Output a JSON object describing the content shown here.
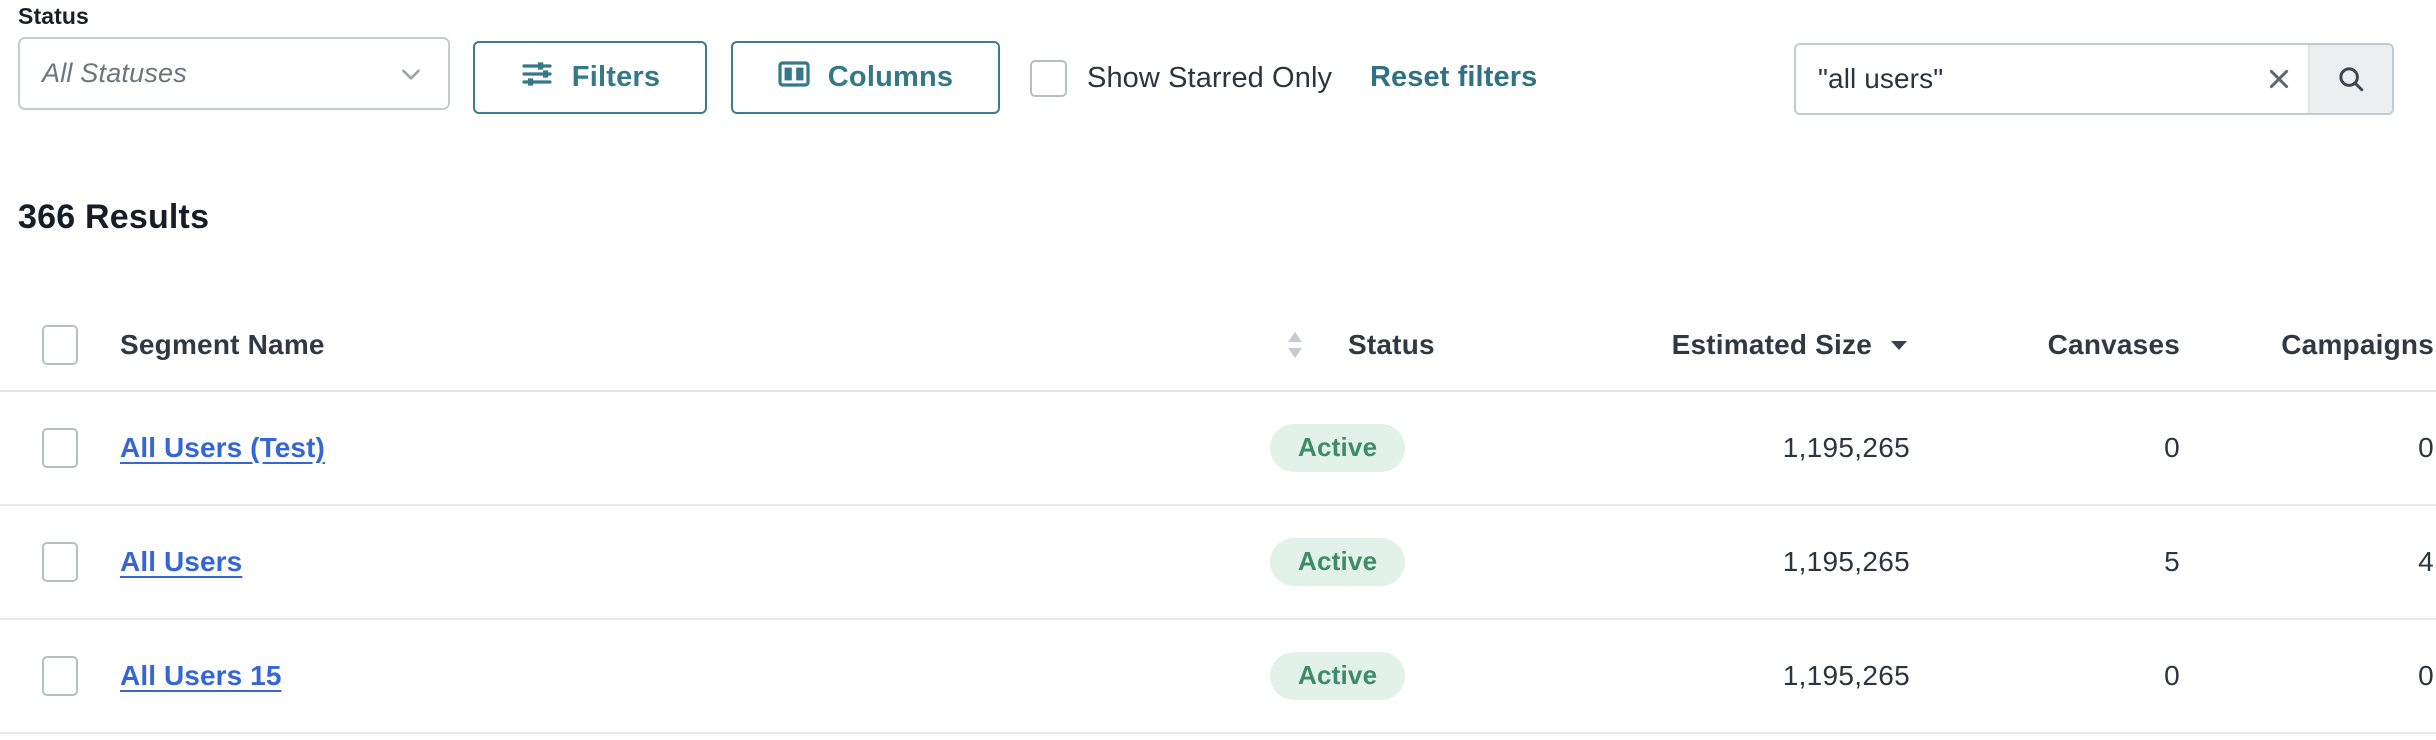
{
  "filters": {
    "status_label": "Status",
    "status_select": {
      "value": "",
      "placeholder": "All Statuses",
      "options": [
        "All Statuses"
      ]
    },
    "filters_button": "Filters",
    "columns_button": "Columns",
    "show_starred_label": "Show Starred Only",
    "show_starred_checked": false,
    "reset_filters_label": "Reset filters",
    "search": {
      "value": "\"all users\"",
      "placeholder": ""
    }
  },
  "results": {
    "count_label": "366 Results"
  },
  "table": {
    "columns": [
      {
        "key": "name",
        "label": "Segment Name",
        "sort": "none"
      },
      {
        "key": "status",
        "label": "Status",
        "sort": null
      },
      {
        "key": "size",
        "label": "Estimated Size",
        "sort": "desc"
      },
      {
        "key": "canvases",
        "label": "Canvases",
        "sort": null
      },
      {
        "key": "campaigns",
        "label": "Campaigns",
        "sort": null
      }
    ],
    "rows": [
      {
        "name": "All Users (Test)",
        "status": "Active",
        "size": "1,195,265",
        "canvases": "0",
        "campaigns": "0",
        "selected": false
      },
      {
        "name": "All Users",
        "status": "Active",
        "size": "1,195,265",
        "canvases": "5",
        "campaigns": "4",
        "selected": false
      },
      {
        "name": "All Users 15",
        "status": "Active",
        "size": "1,195,265",
        "canvases": "0",
        "campaigns": "0",
        "selected": false
      }
    ]
  },
  "colors": {
    "accent_teal": "#35788a",
    "link_blue": "#3566d6",
    "badge_bg": "#e2f1e9",
    "badge_text": "#3d8c67",
    "text_dark": "#242c36",
    "border_gray": "#c5cdd2"
  }
}
